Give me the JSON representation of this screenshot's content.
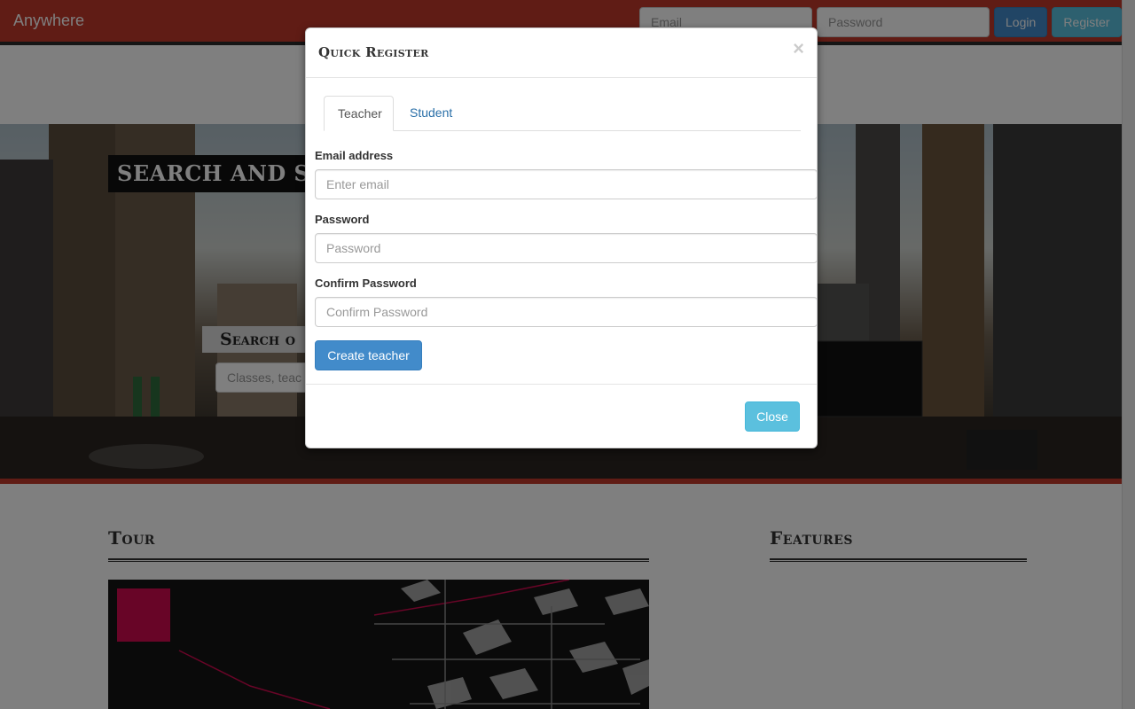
{
  "navbar": {
    "brand": "Anywhere",
    "email_placeholder": "Email",
    "password_placeholder": "Password",
    "login_label": "Login",
    "register_label": "Register"
  },
  "hero": {
    "title": "Search and Sha",
    "subtitle": "Search o",
    "search_placeholder": "Classes, teac"
  },
  "sections": {
    "tour_title": "Tour",
    "features_title": "Features"
  },
  "modal": {
    "title": "Quick Register",
    "close_symbol": "×",
    "tabs": [
      {
        "label": "Teacher",
        "active": true
      },
      {
        "label": "Student",
        "active": false
      }
    ],
    "fields": {
      "email": {
        "label": "Email address",
        "placeholder": "Enter email"
      },
      "password": {
        "label": "Password",
        "placeholder": "Password"
      },
      "confirm": {
        "label": "Confirm Password",
        "placeholder": "Confirm Password"
      }
    },
    "submit_label": "Create teacher",
    "close_label": "Close"
  },
  "colors": {
    "navbar": "#c0392b",
    "primary": "#428bca",
    "info": "#5bc0de",
    "tour_accent": "#d10a4f"
  }
}
